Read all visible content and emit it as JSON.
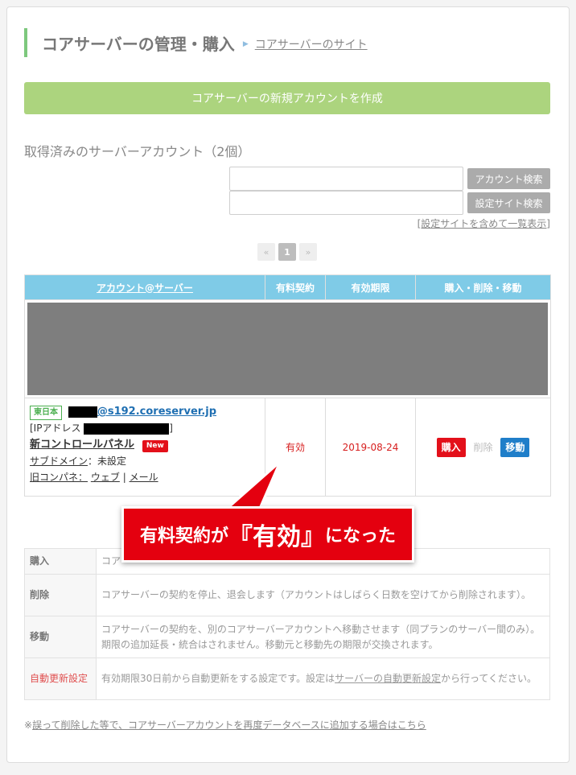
{
  "header": {
    "title": "コアサーバーの管理・購入",
    "site_link": "コアサーバーのサイト"
  },
  "create_button": "コアサーバーの新規アカウントを作成",
  "accounts_title": "取得済みのサーバーアカウント（2個）",
  "search": {
    "account_button": "アカウント検索",
    "site_button": "設定サイト検索",
    "list_all_link": "[設定サイトを含めて一覧表示]"
  },
  "pager": {
    "prev": "«",
    "current": "1",
    "next": "»"
  },
  "table": {
    "headers": [
      "アカウント@サーバー",
      "有料契約",
      "有効期限",
      "購入・削除・移動"
    ],
    "row": {
      "region_tag": "東日本",
      "server_suffix": "@s192.coreserver.jp",
      "ip_prefix": "[IPアドレス",
      "ip_suffix": "]",
      "new_cp": "新コントロールパネル",
      "new_badge": "New",
      "subdomain_label": "サブドメイン",
      "subdomain_value": "：未設定",
      "old_cp_label": "旧コンパネ：",
      "old_cp_web": "ウェブ",
      "old_cp_sep": "|",
      "old_cp_mail": "メール",
      "paid_status": "有効",
      "expiry": "2019-08-24",
      "buy": "購入",
      "delete": "削除",
      "move": "移動"
    }
  },
  "callout": {
    "before": "有料契約が",
    "highlight": "『有効』",
    "after": "になった"
  },
  "legend": [
    {
      "key": "購入",
      "desc": "コア"
    },
    {
      "key": "削除",
      "desc": "コアサーバーの契約を停止、退会します（アカウントはしばらく日数を空けてから削除されます）。"
    },
    {
      "key": "移動",
      "desc": "コアサーバーの契約を、別のコアサーバーアカウントへ移動させます（同プランのサーバー間のみ）。期限の追加延長・統合はされません。移動元と移動先の期限が交換されます。"
    },
    {
      "key": "自動更新設定",
      "desc_before": "有効期限30日前から自動更新をする設定です。設定は",
      "desc_link": "サーバーの自動更新設定",
      "desc_after": "から行ってください。"
    }
  ],
  "footnote": {
    "prefix": "※",
    "link": "誤って削除した等で、コアサーバーアカウントを再度データベースに追加する場合はこちら"
  },
  "colors": {
    "header_bar": "#7dc87d",
    "create_button": "#acd47e",
    "table_header": "#7fcbe7",
    "buy": "#e3101a",
    "move": "#1f7ec9",
    "callout": "#e4000f"
  },
  "icons": {
    "breadcrumb_arrow": "triangle-right-icon"
  }
}
